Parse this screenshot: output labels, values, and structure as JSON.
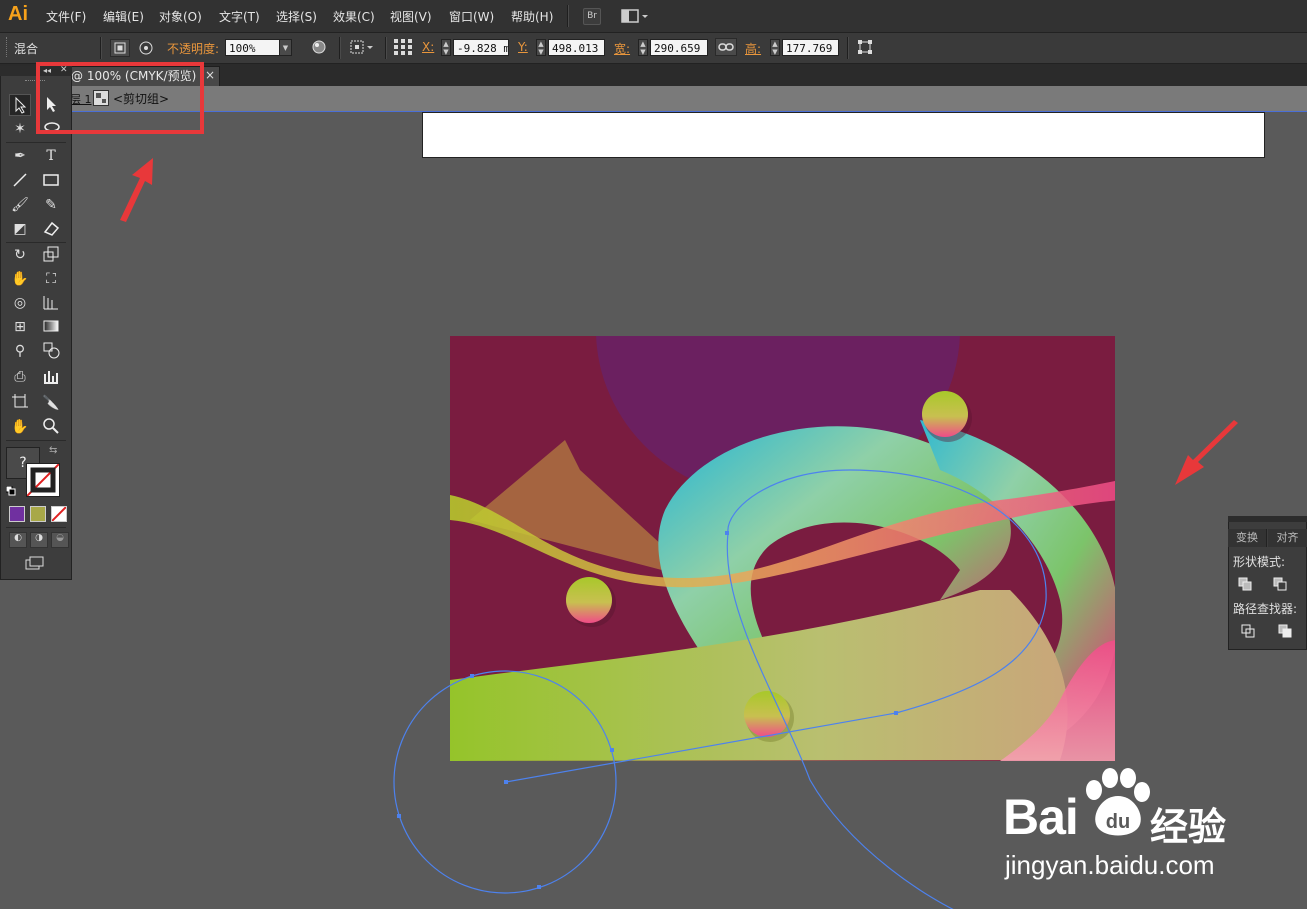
{
  "app": {
    "logo": "Ai",
    "accent": "#f7a21b"
  },
  "menu": [
    "文件(F)",
    "编辑(E)",
    "对象(O)",
    "文字(T)",
    "选择(S)",
    "效果(C)",
    "视图(V)",
    "窗口(W)",
    "帮助(H)"
  ],
  "menu_extra": {
    "bridge": "Br"
  },
  "control": {
    "mode": "混合",
    "opacity_label": "不透明度:",
    "opacity_value": "100%",
    "x_label": "X:",
    "x_value": "-9.828 m",
    "y_label": "Y:",
    "y_value": "498.013 r",
    "w_label": "宽:",
    "w_value": "290.659 r",
    "h_label": "高:",
    "h_value": "177.769 r"
  },
  "doc_tab": {
    "title": "@ 100% (CMYK/预览)",
    "close": "×"
  },
  "breadcrumb": {
    "layer": "层 1",
    "group": "<剪切组>"
  },
  "toolbox": {
    "unknown_fill": "?"
  },
  "panel": {
    "tabs": [
      "变换",
      "对齐"
    ],
    "shape_modes": "形状模式:",
    "pathfinder": "路径查找器:"
  },
  "watermark": {
    "brand": "Bai",
    "brand_cn": "经验",
    "url": "jingyan.baidu.com"
  },
  "colors": {
    "annotation": "#e8383a",
    "art_bg": "#7a1c40",
    "art_purple": "#6b2060",
    "path_blue": "#4d82ee",
    "swatch_purple": "#7030a0",
    "swatch_olive": "#a8a848"
  }
}
